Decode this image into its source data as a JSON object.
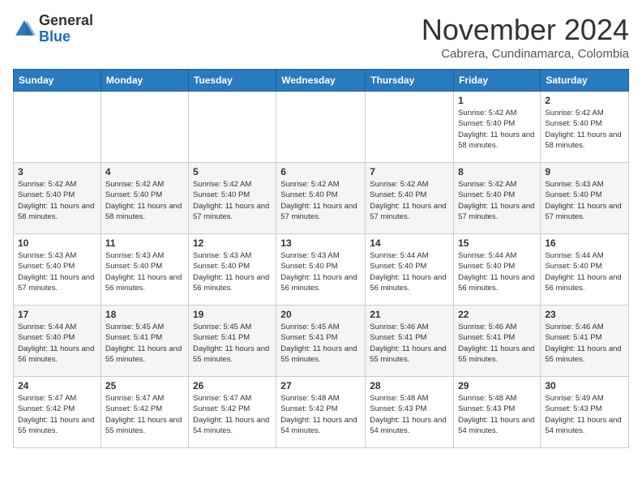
{
  "header": {
    "logo_general": "General",
    "logo_blue": "Blue",
    "month": "November 2024",
    "location": "Cabrera, Cundinamarca, Colombia"
  },
  "weekdays": [
    "Sunday",
    "Monday",
    "Tuesday",
    "Wednesday",
    "Thursday",
    "Friday",
    "Saturday"
  ],
  "weeks": [
    [
      {
        "day": "",
        "info": ""
      },
      {
        "day": "",
        "info": ""
      },
      {
        "day": "",
        "info": ""
      },
      {
        "day": "",
        "info": ""
      },
      {
        "day": "",
        "info": ""
      },
      {
        "day": "1",
        "info": "Sunrise: 5:42 AM\nSunset: 5:40 PM\nDaylight: 11 hours and 58 minutes."
      },
      {
        "day": "2",
        "info": "Sunrise: 5:42 AM\nSunset: 5:40 PM\nDaylight: 11 hours and 58 minutes."
      }
    ],
    [
      {
        "day": "3",
        "info": "Sunrise: 5:42 AM\nSunset: 5:40 PM\nDaylight: 11 hours and 58 minutes."
      },
      {
        "day": "4",
        "info": "Sunrise: 5:42 AM\nSunset: 5:40 PM\nDaylight: 11 hours and 58 minutes."
      },
      {
        "day": "5",
        "info": "Sunrise: 5:42 AM\nSunset: 5:40 PM\nDaylight: 11 hours and 57 minutes."
      },
      {
        "day": "6",
        "info": "Sunrise: 5:42 AM\nSunset: 5:40 PM\nDaylight: 11 hours and 57 minutes."
      },
      {
        "day": "7",
        "info": "Sunrise: 5:42 AM\nSunset: 5:40 PM\nDaylight: 11 hours and 57 minutes."
      },
      {
        "day": "8",
        "info": "Sunrise: 5:42 AM\nSunset: 5:40 PM\nDaylight: 11 hours and 57 minutes."
      },
      {
        "day": "9",
        "info": "Sunrise: 5:43 AM\nSunset: 5:40 PM\nDaylight: 11 hours and 57 minutes."
      }
    ],
    [
      {
        "day": "10",
        "info": "Sunrise: 5:43 AM\nSunset: 5:40 PM\nDaylight: 11 hours and 57 minutes."
      },
      {
        "day": "11",
        "info": "Sunrise: 5:43 AM\nSunset: 5:40 PM\nDaylight: 11 hours and 56 minutes."
      },
      {
        "day": "12",
        "info": "Sunrise: 5:43 AM\nSunset: 5:40 PM\nDaylight: 11 hours and 56 minutes."
      },
      {
        "day": "13",
        "info": "Sunrise: 5:43 AM\nSunset: 5:40 PM\nDaylight: 11 hours and 56 minutes."
      },
      {
        "day": "14",
        "info": "Sunrise: 5:44 AM\nSunset: 5:40 PM\nDaylight: 11 hours and 56 minutes."
      },
      {
        "day": "15",
        "info": "Sunrise: 5:44 AM\nSunset: 5:40 PM\nDaylight: 11 hours and 56 minutes."
      },
      {
        "day": "16",
        "info": "Sunrise: 5:44 AM\nSunset: 5:40 PM\nDaylight: 11 hours and 56 minutes."
      }
    ],
    [
      {
        "day": "17",
        "info": "Sunrise: 5:44 AM\nSunset: 5:40 PM\nDaylight: 11 hours and 56 minutes."
      },
      {
        "day": "18",
        "info": "Sunrise: 5:45 AM\nSunset: 5:41 PM\nDaylight: 11 hours and 55 minutes."
      },
      {
        "day": "19",
        "info": "Sunrise: 5:45 AM\nSunset: 5:41 PM\nDaylight: 11 hours and 55 minutes."
      },
      {
        "day": "20",
        "info": "Sunrise: 5:45 AM\nSunset: 5:41 PM\nDaylight: 11 hours and 55 minutes."
      },
      {
        "day": "21",
        "info": "Sunrise: 5:46 AM\nSunset: 5:41 PM\nDaylight: 11 hours and 55 minutes."
      },
      {
        "day": "22",
        "info": "Sunrise: 5:46 AM\nSunset: 5:41 PM\nDaylight: 11 hours and 55 minutes."
      },
      {
        "day": "23",
        "info": "Sunrise: 5:46 AM\nSunset: 5:41 PM\nDaylight: 11 hours and 55 minutes."
      }
    ],
    [
      {
        "day": "24",
        "info": "Sunrise: 5:47 AM\nSunset: 5:42 PM\nDaylight: 11 hours and 55 minutes."
      },
      {
        "day": "25",
        "info": "Sunrise: 5:47 AM\nSunset: 5:42 PM\nDaylight: 11 hours and 55 minutes."
      },
      {
        "day": "26",
        "info": "Sunrise: 5:47 AM\nSunset: 5:42 PM\nDaylight: 11 hours and 54 minutes."
      },
      {
        "day": "27",
        "info": "Sunrise: 5:48 AM\nSunset: 5:42 PM\nDaylight: 11 hours and 54 minutes."
      },
      {
        "day": "28",
        "info": "Sunrise: 5:48 AM\nSunset: 5:43 PM\nDaylight: 11 hours and 54 minutes."
      },
      {
        "day": "29",
        "info": "Sunrise: 5:48 AM\nSunset: 5:43 PM\nDaylight: 11 hours and 54 minutes."
      },
      {
        "day": "30",
        "info": "Sunrise: 5:49 AM\nSunset: 5:43 PM\nDaylight: 11 hours and 54 minutes."
      }
    ]
  ]
}
